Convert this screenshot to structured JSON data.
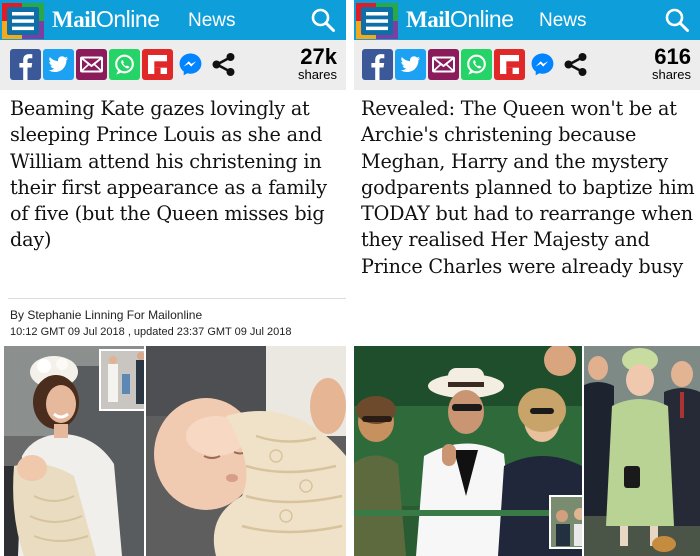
{
  "colors": {
    "topbar": "#0e9fda",
    "sharebar": "#ededed",
    "facebook": "#3b5998",
    "twitter": "#1da1f2",
    "email": "#8a1c5c",
    "whatsapp": "#25d366",
    "flipboard": "#e12828",
    "messenger": "#0084ff"
  },
  "icons": [
    "hamburger-menu-icon",
    "search-icon",
    "facebook-icon",
    "twitter-icon",
    "email-icon",
    "whatsapp-icon",
    "flipboard-icon",
    "messenger-icon",
    "share-icon"
  ],
  "left": {
    "brand_mail": "Mail",
    "brand_online": "Online",
    "section": "News",
    "share_count": "27k",
    "share_label": "shares",
    "headline": "Beaming Kate gazes lovingly at sleeping Prince Louis as she and William attend his christening in their first appearance as a family of five (but the Queen misses big day)",
    "byline": "By Stephanie Linning For Mailonline",
    "dateline": "10:12 GMT 09 Jul 2018 , updated 23:37 GMT 09 Jul 2018"
  },
  "right": {
    "brand_mail": "Mail",
    "brand_online": "Online",
    "section": "News",
    "share_count": "616",
    "share_label": "shares",
    "headline": "Revealed: The Queen won't be at Archie's christening because Meghan, Harry and the mystery godparents planned to baptize him TODAY but had to rearrange when they realised Her Majesty and Prince Charles were already busy"
  }
}
